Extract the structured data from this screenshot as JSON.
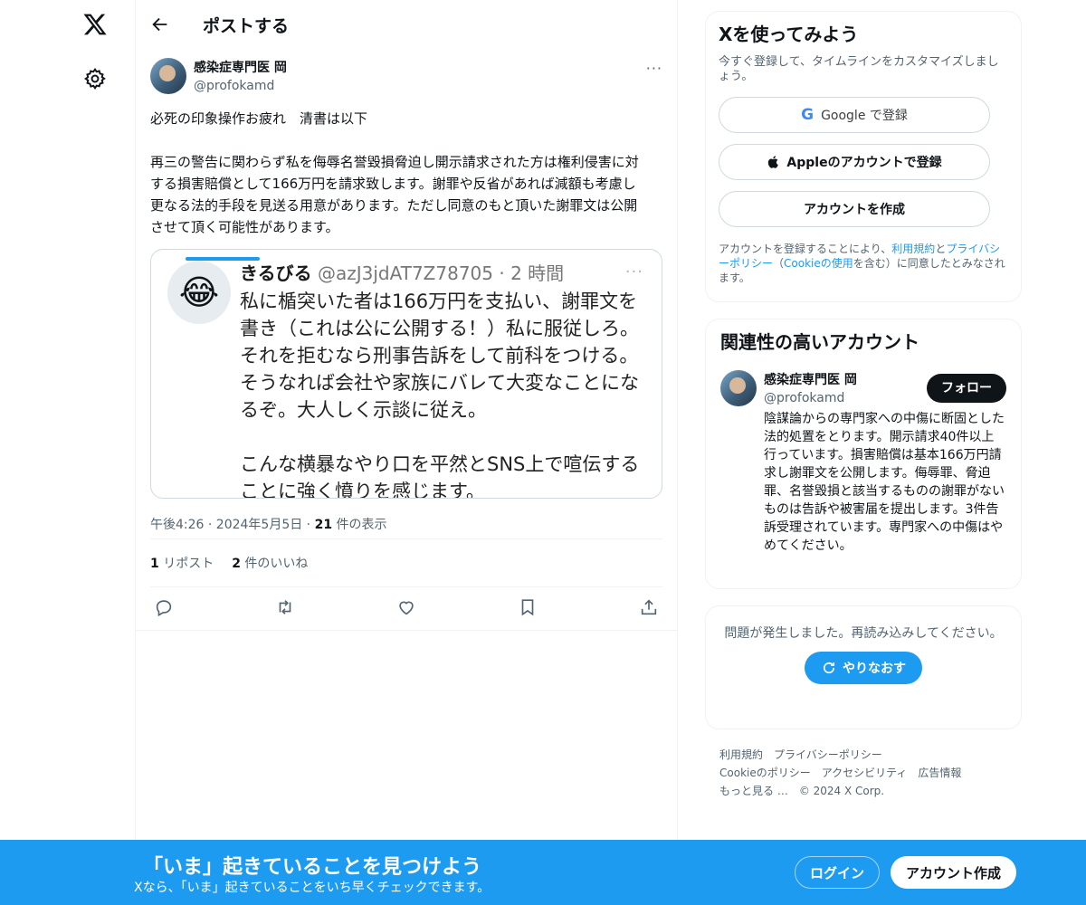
{
  "nav": {
    "logo_icon": "x-logo-icon",
    "settings_icon": "gear-icon"
  },
  "header": {
    "back_icon": "arrow-left-icon",
    "title": "ポストする"
  },
  "post": {
    "author_name": "感染症専門医 岡",
    "author_handle": "@profokamd",
    "more": "···",
    "text": "必死の印象操作お疲れ　清書は以下\n\n再三の警告に関わらず私を侮辱名誉毀損脅迫し開示請求された方は権利侵害に対する損害賠償として166万円を請求致します。謝罪や反省があれば減額も考慮し更なる法的手段を見送る用意があります。ただし同意のもと頂いた謝罪文は公開させて頂く可能性があります。",
    "media": {
      "name": "きるびる",
      "handle_time": " @azJ3jdAT7Z78705 · 2 時間",
      "dots": "···",
      "emoji": "😂",
      "body": "私に楯突いた者は166万円を支払い、謝罪文を書き（これは公に公開する！）私に服従しろ。それを拒むなら刑事告訴をして前科をつける。そうなれば会社や家族にバレて大変なことになるぞ。大人しく示談に従え。\n\nこんな横暴なやり口を平然とSNS上で喧伝することに強く憤りを感じます。"
    },
    "timestamp": "午後4:26 · 2024年5月5日 · ",
    "views_count": "21",
    "views_label": " 件の表示",
    "reposts_count": "1",
    "reposts_label": " リポスト",
    "likes_count": "2",
    "likes_label": " 件のいいね",
    "actions": [
      "reply-icon",
      "repost-icon",
      "like-icon",
      "bookmark-icon",
      "share-icon"
    ]
  },
  "signup": {
    "title": "Xを使ってみよう",
    "subtitle": "今すぐ登録して、タイムラインをカスタマイズしましょう。",
    "google_label": "Google で登録",
    "apple_label": "Appleのアカウントで登録",
    "create_label": "アカウントを作成",
    "legal_1": "アカウントを登録することにより、",
    "legal_terms": "利用規約",
    "legal_2": "と",
    "legal_privacy": "プライバシーポリシー",
    "legal_3": "（",
    "legal_cookie": "Cookieの使用",
    "legal_4": "を含む）に同意したとみなされます。"
  },
  "related": {
    "title": "関連性の高いアカウント",
    "name": "感染症専門医 岡",
    "handle": "@profokamd",
    "follow_label": "フォロー",
    "bio": "陰謀論からの専門家への中傷に断固とした法的処置をとります。開示請求40件以上行っています。損害賠償は基本166万円請求し謝罪文を公開します。侮辱罪、脅迫罪、名誉毀損と該当するものの謝罪がないものは告訴や被害届を提出します。3件告訴受理されています。専門家への中傷はやめてください。"
  },
  "error": {
    "message": "問題が発生しました。再読み込みしてください。",
    "retry_label": "やりなおす"
  },
  "footer": {
    "terms": "利用規約",
    "privacy": "プライバシーポリシー",
    "cookie": "Cookieのポリシー",
    "accessibility": "アクセシビリティ",
    "ads": "広告情報",
    "more": "もっと見る …",
    "copyright": "© 2024 X Corp."
  },
  "banner": {
    "title": "「いま」起きていることを見つけよう",
    "subtitle": "Xなら、「いま」起きていることをいち早くチェックできます。",
    "login_label": "ログイン",
    "create_label": "アカウント作成"
  },
  "colors": {
    "accent": "#1d9bf0",
    "text": "#0f1419",
    "muted": "#536471"
  }
}
